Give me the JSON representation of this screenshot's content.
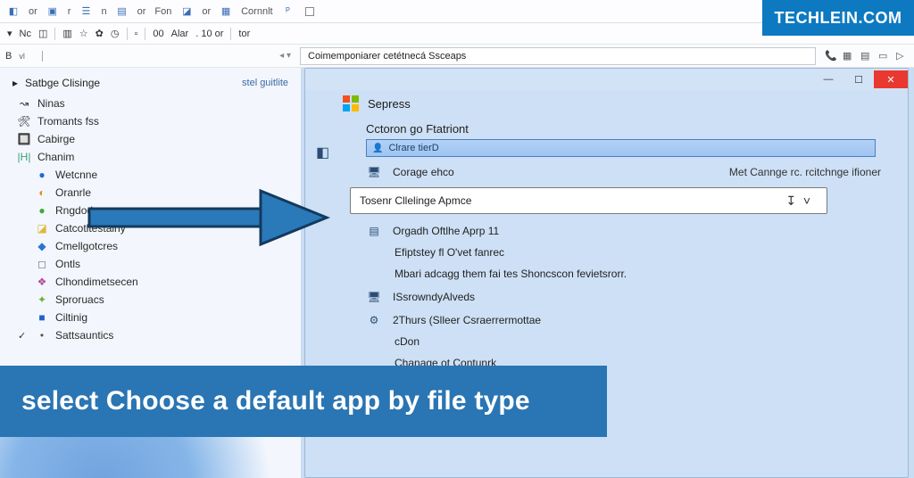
{
  "watermark": "TECHLEIN.COM",
  "banner": "select Choose a default app by file type",
  "toolbar_top": {
    "items": [
      "or",
      "r",
      "n",
      "or",
      "Fon",
      "or",
      "Cornnlt",
      " "
    ]
  },
  "toolbar_second": {
    "items": [
      "",
      "Nc",
      "",
      "",
      "",
      "",
      "",
      "",
      "",
      "",
      "",
      "",
      "00",
      "Alar",
      ". 10  or",
      "tor"
    ]
  },
  "address": {
    "left_label": "B",
    "left_small": "vl",
    "path": "Coimemponiarer cetétnecá Ssceaps"
  },
  "left_panel": {
    "header_title": "Satbge Clisinge",
    "header_action": "stel guitlite",
    "items": [
      {
        "icon": "⋯",
        "label": "Ninas"
      },
      {
        "icon": "📄",
        "label": "Tromants fss"
      },
      {
        "icon": "🔲",
        "label": "Cabirge"
      },
      {
        "icon": "|H|",
        "label": "Chanim"
      },
      {
        "icon": "🔵",
        "label": "Wetcnne",
        "indent": true
      },
      {
        "icon": "◐",
        "label": "Oranrle",
        "indent": true
      },
      {
        "icon": "🟢",
        "label": "Rngdod cnn",
        "indent": true
      },
      {
        "icon": "🟨",
        "label": "Catcotltestalny",
        "indent": true
      },
      {
        "icon": "🔷",
        "label": "Cmellgotcres",
        "indent": true
      },
      {
        "icon": "▫",
        "label": "Ontls",
        "indent": true
      },
      {
        "icon": "🟪",
        "label": "Clhondimetsecen",
        "indent": true
      },
      {
        "icon": "✦",
        "label": "Sproruacs",
        "indent": true
      },
      {
        "icon": "🟦",
        "label": "Ciltinig",
        "indent": true
      },
      {
        "icon": "•",
        "label": "Sattsauntics",
        "indent": true,
        "checked": true
      }
    ]
  },
  "settings_window": {
    "title": "Sepress",
    "section": "Cctoron go Ftatriont",
    "bluebar": "Clrare tierD",
    "row_change": {
      "label": "Corage ehco",
      "sub": "Met Cannge rc. rcitchnge ifioner"
    },
    "dropdown": "Tosenr Cllelinge Apmce",
    "opt1": "Orgadh Oftlhe Aprp 11",
    "opt2": "Efiptstey fl O'vet fanrec",
    "desc": "Mbari adcagg them fai tes Shoncscon fevietsrorr.",
    "opt3": "ISsrowndyAlveds",
    "opt4": "2Thurs (Slleer Csraerrermottae",
    "opt5": "cDon",
    "opt6": "Chanage ot Contunrk"
  }
}
